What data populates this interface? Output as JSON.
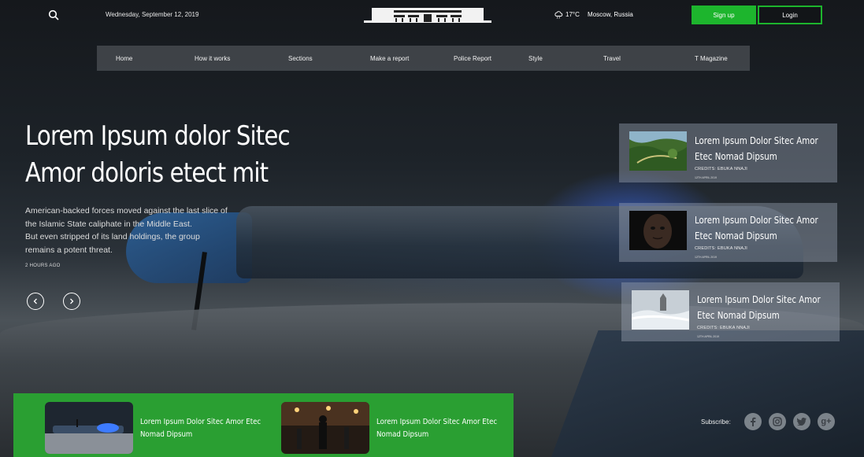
{
  "header": {
    "date": "Wednesday, September 12, 2019",
    "logo_text": "PRISON",
    "temperature": "17°C",
    "location": "Moscow, Russia",
    "signup_label": "Sign up",
    "login_label": "Login"
  },
  "nav": {
    "items": [
      {
        "label": "Home"
      },
      {
        "label": "How it works"
      },
      {
        "label": "Sections"
      },
      {
        "label": "Make a report"
      },
      {
        "label": "Police Report"
      },
      {
        "label": "Style"
      },
      {
        "label": "Travel"
      },
      {
        "label": "T Magazine"
      }
    ]
  },
  "hero": {
    "title_line1": "Lorem Ipsum dolor Sitec",
    "title_line2": "Amor doloris etect mit",
    "desc_line1": "American-backed forces moved against the last slice of",
    "desc_line2": "the Islamic State caliphate in the Middle East.",
    "desc_line3": "But even stripped of its land holdings, the group",
    "desc_line4": "remains a potent threat.",
    "time": "2 HOURS AGO"
  },
  "side_cards": [
    {
      "title_line1": "Lorem Ipsum Dolor Sitec Amor",
      "title_line2": "Etec Nomad Dipsum",
      "credit": "CREDITS:  EBUKA NNAJI",
      "date": "12TH APRIL 2019"
    },
    {
      "title_line1": "Lorem Ipsum Dolor Sitec Amor",
      "title_line2": "Etec Nomad Dipsum",
      "credit": "CREDITS:  EBUKA NNAJI",
      "date": "12TH APRIL 2019"
    },
    {
      "title_line1": "Lorem Ipsum Dolor Sitec Amor",
      "title_line2": "Etec Nomad Dipsum",
      "credit": "CREDITS:  EBUKA NNAJI",
      "date": "12TH APRIL 2019"
    }
  ],
  "bottom_cards": [
    {
      "title_line1": "Lorem Ipsum Dolor Sitec Amor Etec",
      "title_line2": "Nomad Dipsum"
    },
    {
      "title_line1": "Lorem Ipsum Dolor Sitec Amor Etec",
      "title_line2": "Nomad Dipsum"
    }
  ],
  "subscribe": {
    "label": "Subscribe:",
    "icons": [
      "facebook-icon",
      "instagram-icon",
      "twitter-icon",
      "google-plus-icon"
    ]
  },
  "colors": {
    "accent": "#1db52d",
    "bottom_panel": "#2a9f32"
  }
}
